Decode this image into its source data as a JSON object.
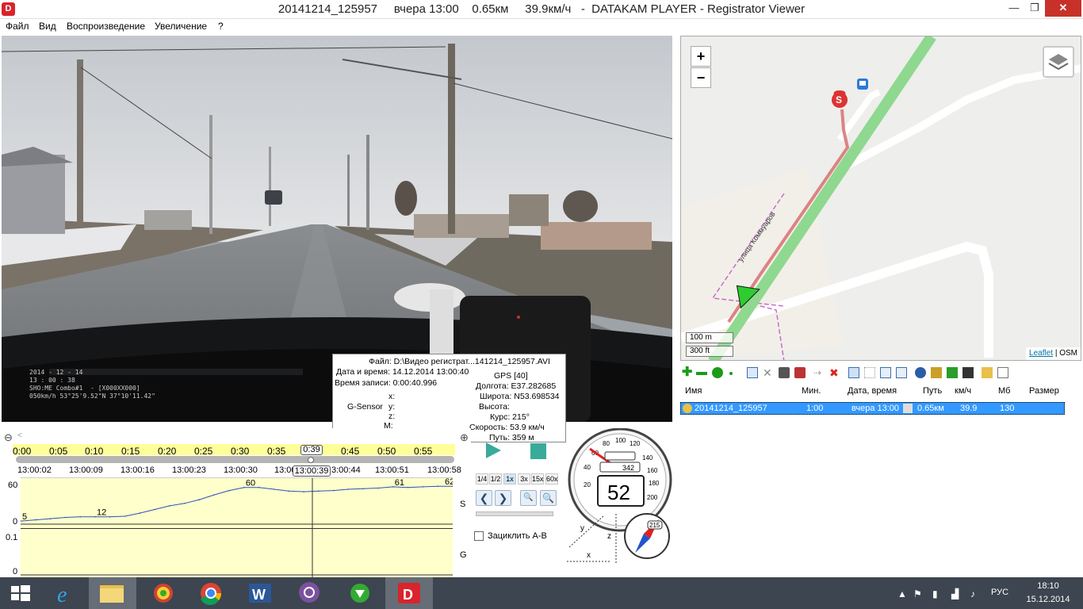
{
  "window": {
    "app_icon": "D",
    "title": "20141214_125957     вчера 13:00    0.65км     39.9км/ч   -  DATAKAM PLAYER - Registrator Viewer",
    "min": "—",
    "max": "❐",
    "close": "✕"
  },
  "menu": [
    "Файл",
    "Вид",
    "Воспроизведение",
    "Увеличение",
    "?"
  ],
  "video": {
    "overlay_lines": [
      "2014 - 12 - 14",
      "13 : 00 : 38",
      "SHO:ME Combo#1  - [X000XX000]",
      "050km/h 53°25'9.52\"N 37°10'11.42\""
    ]
  },
  "info": {
    "file": "Файл: D:\\Видео регистрат...141214_125957.AVI",
    "datetime": "Дата и время: 14.12.2014 13:00:40",
    "rec_time": "Время записи: 0:00:40.996",
    "gps": "GPS [40]",
    "lon": "Долгота: E37.282685",
    "lat": "Широта: N53.698534",
    "alt": "Высота:",
    "course": "Курс: 215°",
    "speed": "Скорость: 53.9 км/ч",
    "path": "Путь: 359 м",
    "gsensor": "G-Sensor",
    "x": "x:",
    "y": "y:",
    "z": "z:",
    "m": "M:"
  },
  "timeline": {
    "zoom_out": "⊖",
    "zoom_in": "⊕",
    "ticks": [
      "0:00",
      "0:05",
      "0:10",
      "0:15",
      "0:20",
      "0:25",
      "0:30",
      "0:35",
      "0:45",
      "0:50",
      "0:55"
    ],
    "current": "0:39",
    "clock_ticks": [
      "13:00:02",
      "13:00:09",
      "13:00:16",
      "13:00:23",
      "13:00:30",
      "13:00:",
      "3:00:44",
      "13:00:51",
      "13:00:58"
    ],
    "current_clock": "13:00:39",
    "s_axis": [
      "60",
      "0"
    ],
    "g_axis": [
      "0.1",
      "0"
    ],
    "s_label": "S",
    "g_label": "G",
    "annotations": [
      "5",
      "12",
      "60",
      "61",
      "62"
    ]
  },
  "chart_data": {
    "type": "line",
    "title": "",
    "xlabel": "",
    "ylabel": "S",
    "x_unit": "s",
    "x": [
      0,
      2,
      4,
      6,
      8,
      10,
      12,
      14,
      16,
      18,
      20,
      22,
      24,
      26,
      28,
      30,
      32,
      34,
      36,
      38,
      40,
      42,
      44,
      46,
      48,
      50,
      52,
      54,
      56,
      58
    ],
    "series": [
      {
        "values": [
          5,
          7,
          9,
          11,
          12,
          12,
          12,
          13,
          18,
          24,
          30,
          34,
          40,
          48,
          55,
          60,
          60,
          57,
          54,
          53,
          54,
          55,
          57,
          58,
          59,
          61,
          60,
          61,
          62,
          62
        ]
      }
    ],
    "ylim": [
      0,
      70
    ],
    "xlim": [
      0,
      58
    ]
  },
  "controls": {
    "speeds": [
      "1/4",
      "1/2",
      "1x",
      "3x",
      "15x",
      "60x"
    ],
    "prev": "❮",
    "next": "❯",
    "zoom_minus": "🔍",
    "zoom_plus": "🔍",
    "loop_label": "Зациклить А-В"
  },
  "speedometer": {
    "value": 52,
    "odometer": "342",
    "ticks": [
      "20",
      "40",
      "60",
      "80",
      "100",
      "120",
      "140",
      "160",
      "180",
      "200"
    ],
    "compass": "215",
    "axes": [
      "y",
      "x",
      "z"
    ]
  },
  "map": {
    "zoom_in": "+",
    "zoom_out": "−",
    "scale_m": "100 m",
    "scale_ft": "300 ft",
    "leaflet": "Leaflet",
    "osm": "OSM",
    "street": "улица Коммуаров",
    "start_marker": "S",
    "colors": {
      "route": "#d87070",
      "road": "#7fce7f",
      "arrow": "#2ecc2e"
    }
  },
  "table": {
    "headers": [
      "Имя",
      "Мин.",
      "Дата, время",
      "Путь",
      "км/ч",
      "Мб",
      "Размер"
    ],
    "rows": [
      {
        "name": "20141214_125957",
        "min": "1:00",
        "datetime": "вчера 13:00",
        "path": "0.65км",
        "speed": "39.9",
        "mb": "130",
        "size": ""
      }
    ]
  },
  "taskbar": {
    "lang": "РУС",
    "time": "18:10",
    "date": "15.12.2014"
  }
}
